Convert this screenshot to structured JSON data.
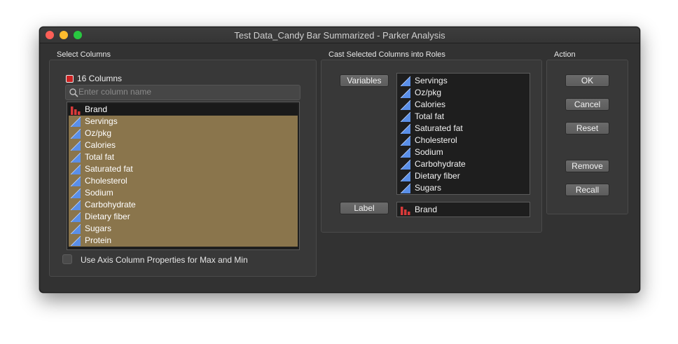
{
  "window": {
    "title": "Test Data_Candy Bar Summarized - Parker Analysis"
  },
  "select_columns": {
    "heading": "Select Columns",
    "count_label": "16 Columns",
    "search_placeholder": "Enter column name",
    "items": [
      {
        "label": "Brand",
        "icon": "nominal-bar-icon",
        "state": "selected-dark"
      },
      {
        "label": "Servings",
        "icon": "continuous-triangle-icon",
        "state": "selected"
      },
      {
        "label": "Oz/pkg",
        "icon": "continuous-triangle-icon",
        "state": "selected"
      },
      {
        "label": "Calories",
        "icon": "continuous-triangle-icon",
        "state": "selected"
      },
      {
        "label": "Total fat",
        "icon": "continuous-triangle-icon",
        "state": "selected"
      },
      {
        "label": "Saturated fat",
        "icon": "continuous-triangle-icon",
        "state": "selected"
      },
      {
        "label": "Cholesterol",
        "icon": "continuous-triangle-icon",
        "state": "selected"
      },
      {
        "label": "Sodium",
        "icon": "continuous-triangle-icon",
        "state": "selected"
      },
      {
        "label": "Carbohydrate",
        "icon": "continuous-triangle-icon",
        "state": "selected"
      },
      {
        "label": "Dietary fiber",
        "icon": "continuous-triangle-icon",
        "state": "selected"
      },
      {
        "label": "Sugars",
        "icon": "continuous-triangle-icon",
        "state": "selected"
      },
      {
        "label": "Protein",
        "icon": "continuous-triangle-icon",
        "state": "selected"
      }
    ],
    "axis_checkbox_label": "Use Axis Column Properties for Max and Min"
  },
  "cast_roles": {
    "heading": "Cast Selected Columns into Roles",
    "variables_button": "Variables",
    "variables": [
      "Servings",
      "Oz/pkg",
      "Calories",
      "Total fat",
      "Saturated fat",
      "Cholesterol",
      "Sodium",
      "Carbohydrate",
      "Dietary fiber",
      "Sugars"
    ],
    "label_button": "Label",
    "label_items": [
      "Brand"
    ]
  },
  "action": {
    "heading": "Action",
    "ok": "OK",
    "cancel": "Cancel",
    "reset": "Reset",
    "remove": "Remove",
    "recall": "Recall"
  },
  "colors": {
    "selection_tan": "#8a754c",
    "continuous_icon": "#5a8fe8",
    "nominal_icon": "#d93a3a"
  }
}
